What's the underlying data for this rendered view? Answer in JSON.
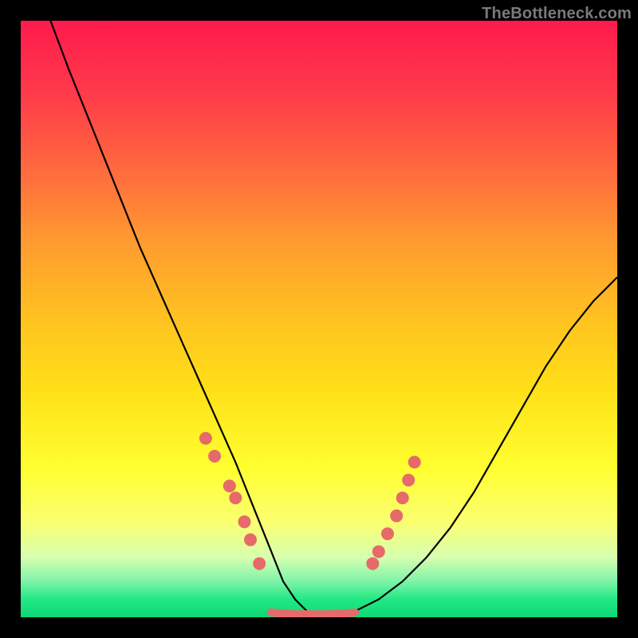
{
  "watermark": "TheBottleneck.com",
  "chart_data": {
    "type": "line",
    "title": "",
    "xlabel": "",
    "ylabel": "",
    "xlim": [
      0,
      100
    ],
    "ylim": [
      0,
      100
    ],
    "grid": false,
    "legend": false,
    "series": [
      {
        "name": "bottleneck-curve",
        "color": "#000000",
        "x": [
          5,
          8,
          12,
          16,
          20,
          24,
          28,
          32,
          36,
          38,
          40,
          42,
          44,
          46,
          48,
          50,
          52,
          56,
          60,
          64,
          68,
          72,
          76,
          80,
          84,
          88,
          92,
          96,
          100
        ],
        "y": [
          100,
          92,
          82,
          72,
          62,
          53,
          44,
          35,
          26,
          21,
          16,
          11,
          6,
          3,
          1,
          0,
          0,
          1,
          3,
          6,
          10,
          15,
          21,
          28,
          35,
          42,
          48,
          53,
          57
        ]
      },
      {
        "name": "highlight-dots-left",
        "color": "#e66a6a",
        "type": "scatter",
        "x": [
          31,
          32.5,
          35,
          36,
          37.5,
          38.5,
          40
        ],
        "y": [
          30,
          27,
          22,
          20,
          16,
          13,
          9
        ]
      },
      {
        "name": "highlight-dots-right",
        "color": "#e66a6a",
        "type": "scatter",
        "x": [
          59,
          60,
          61.5,
          63,
          64,
          65,
          66
        ],
        "y": [
          9,
          11,
          14,
          17,
          20,
          23,
          26
        ]
      },
      {
        "name": "highlight-baseline",
        "color": "#e66a6a",
        "type": "line",
        "x": [
          42,
          44,
          46,
          48,
          50,
          52,
          54,
          56
        ],
        "y": [
          0.8,
          0.6,
          0.5,
          0.5,
          0.5,
          0.5,
          0.6,
          0.8
        ]
      }
    ],
    "annotations": []
  }
}
